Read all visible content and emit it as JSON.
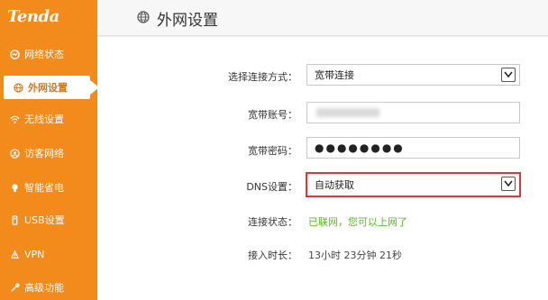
{
  "brand": {
    "logo_text": "Tenda"
  },
  "sidebar": {
    "items": [
      {
        "label": "网络状态",
        "icon": "network-status-icon",
        "active": false
      },
      {
        "label": "外网设置",
        "icon": "globe-icon",
        "active": true
      },
      {
        "label": "无线设置",
        "icon": "wifi-icon",
        "active": false
      },
      {
        "label": "访客网络",
        "icon": "guest-network-icon",
        "active": false
      },
      {
        "label": "智能省电",
        "icon": "lightbulb-icon",
        "active": false
      },
      {
        "label": "USB设置",
        "icon": "usb-icon",
        "active": false
      },
      {
        "label": "VPN",
        "icon": "vpn-icon",
        "active": false
      },
      {
        "label": "高级功能",
        "icon": "advanced-icon",
        "active": false
      }
    ]
  },
  "header": {
    "title": "外网设置",
    "icon": "globe-icon"
  },
  "form": {
    "connection_type": {
      "label": "选择连接方式：",
      "value": "宽带连接"
    },
    "account": {
      "label": "宽带账号：",
      "value": ""
    },
    "password": {
      "label": "宽带密码：",
      "value": "●●●●●●●●"
    },
    "dns": {
      "label": "DNS设置：",
      "value": "自动获取"
    },
    "status": {
      "label": "连接状态：",
      "value": "已联网，您可以上网了"
    },
    "uptime": {
      "label": "接入时长：",
      "value": "13小时 23分钟 21秒"
    }
  },
  "colors": {
    "sidebar": "#f28a1c",
    "status_ok": "#5cb82a",
    "highlight": "#d9363e"
  }
}
